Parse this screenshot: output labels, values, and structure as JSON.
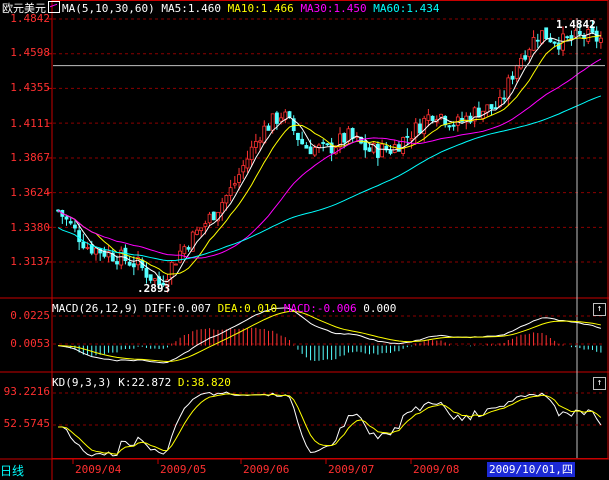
{
  "main": {
    "symbol": "欧元美元",
    "indicator": "MA(5,10,30,60)",
    "ma": [
      {
        "label": "MA5:1.460",
        "color": "#ffffff"
      },
      {
        "label": "MA10:1.466",
        "color": "#ffff00"
      },
      {
        "label": "MA30:1.450",
        "color": "#ff00ff"
      },
      {
        "label": "MA60:1.434",
        "color": "#00ffff"
      }
    ],
    "y_ticks": [
      "1.4842",
      "1.4598",
      "1.4355",
      "1.4111",
      "1.3867",
      "1.3624",
      "1.3380",
      "1.3137"
    ],
    "y_values": [
      1.4842,
      1.4598,
      1.4355,
      1.4111,
      1.3867,
      1.3624,
      1.338,
      1.3137
    ],
    "high_label": "1.4842",
    "low_label": ".2893",
    "crosshair_price": 1.4515
  },
  "macd": {
    "title": "MACD(26,12,9)",
    "diff": "DIFF:0.007",
    "dea": "DEA:0.010",
    "macd": "MACD:-0.006",
    "extra": "0.000",
    "y_ticks": [
      "0.0225",
      "0.0053"
    ],
    "y_values": [
      0.0225,
      0.0053
    ],
    "zero": 0.0
  },
  "kd": {
    "title": "KD(9,3,3)",
    "k": "K:22.872",
    "d": "D:38.820",
    "y_ticks": [
      "93.2216",
      "52.5745"
    ],
    "y_values": [
      93.2216,
      52.5745
    ]
  },
  "xaxis": {
    "period": "日线",
    "months": [
      "2009/04",
      "2009/05",
      "2009/06",
      "2009/07",
      "2009/08"
    ],
    "cursor_date": "2009/10/01,四"
  },
  "buttons": {
    "up": "↑"
  },
  "colors": {
    "up": "#ff3232",
    "down": "#54ffff",
    "axis": "#c80000",
    "ma5": "#ffffff",
    "ma10": "#ffff00",
    "ma30": "#ff00ff",
    "ma60": "#00ffff"
  }
}
